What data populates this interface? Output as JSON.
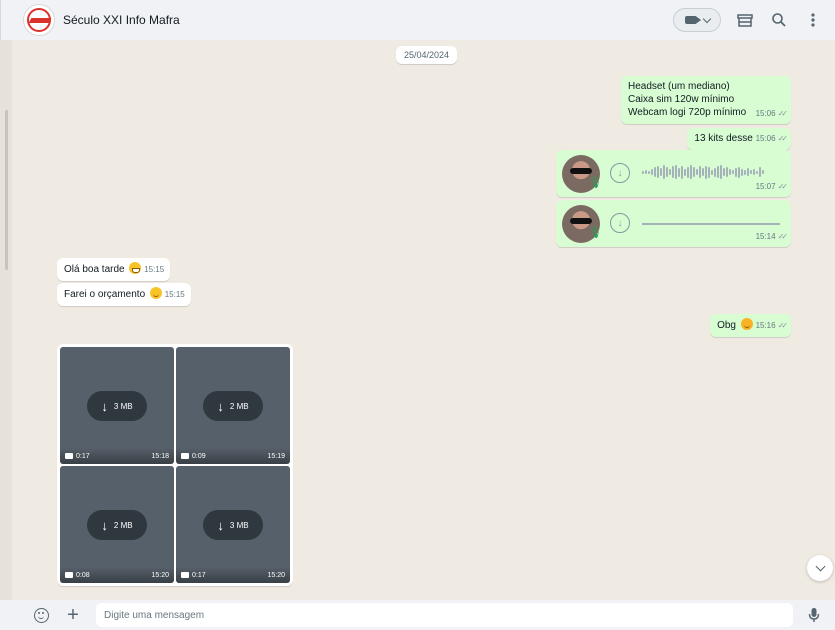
{
  "header": {
    "contact_name": "Século XXI Info Mafra"
  },
  "chat": {
    "date": "25/04/2024",
    "messages": [
      {
        "lines": [
          "Headset (um mediano)",
          "Caixa sim 120w mínimo",
          "Webcam logi 720p mínimo"
        ],
        "time": "15:06",
        "direction": "out"
      },
      {
        "text": "13 kits desse",
        "time": "15:06",
        "direction": "out"
      },
      {
        "type": "voice",
        "time": "15:07",
        "direction": "out"
      },
      {
        "type": "voice",
        "time": "15:14",
        "direction": "out"
      },
      {
        "text": "Olá boa tarde",
        "emoji": "grinning-face",
        "time": "15:15",
        "direction": "in"
      },
      {
        "text": "Farei o orçamento",
        "emoji": "winking-face",
        "time": "15:15",
        "direction": "in"
      },
      {
        "text": "Obg",
        "emoji": "smiling-face",
        "time": "15:16",
        "direction": "out"
      }
    ],
    "media": [
      {
        "size": "3 MB",
        "duration": "0:17",
        "time": "15:18"
      },
      {
        "size": "2 MB",
        "duration": "0:09",
        "time": "15:19"
      },
      {
        "size": "2 MB",
        "duration": "0:08",
        "time": "15:20"
      },
      {
        "size": "3 MB",
        "duration": "0:17",
        "time": "15:20"
      }
    ]
  },
  "footer": {
    "placeholder": "Digite uma mensagem"
  },
  "colors": {
    "outgoing_bubble": "#d9fdd3",
    "incoming_bubble": "#ffffff",
    "chat_background": "#efeae2",
    "header_background": "#f0f2f5"
  }
}
